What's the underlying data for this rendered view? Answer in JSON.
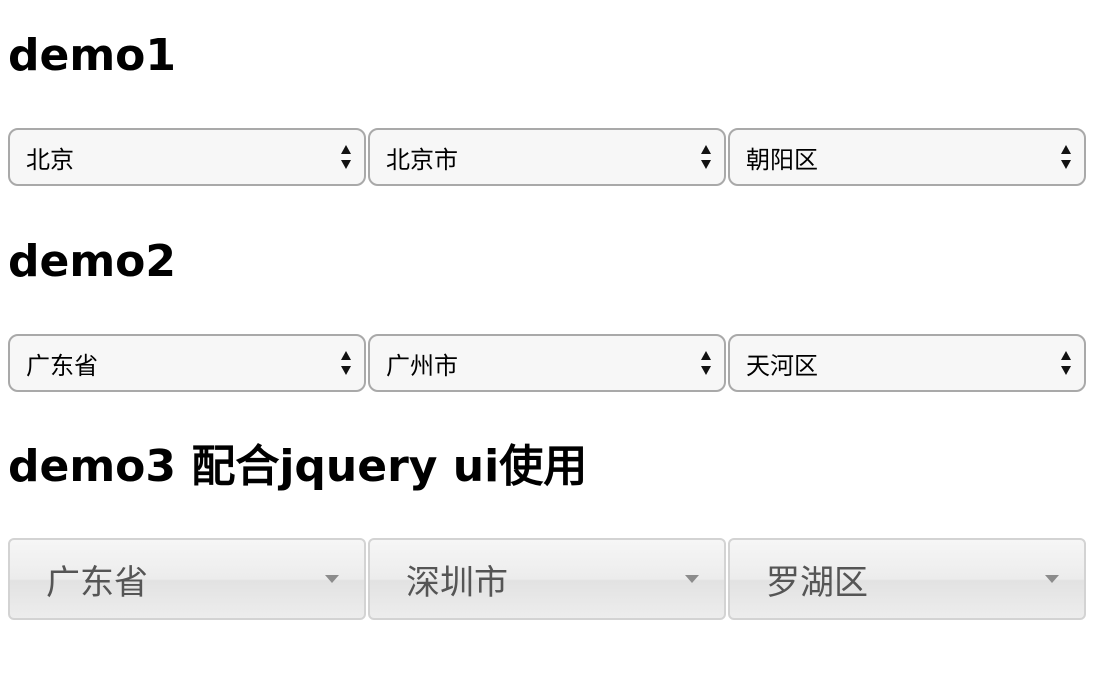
{
  "demo1": {
    "heading": "demo1",
    "province": "北京",
    "city": "北京市",
    "district": "朝阳区"
  },
  "demo2": {
    "heading": "demo2",
    "province": "广东省",
    "city": "广州市",
    "district": "天河区"
  },
  "demo3": {
    "heading": "demo3 配合jquery ui使用",
    "province": "广东省",
    "city": "深圳市",
    "district": "罗湖区"
  },
  "icons": {
    "native_select_arrow": "up-down-arrows-icon",
    "ui_select_arrow": "caret-down-icon"
  },
  "colors": {
    "native_border": "#a9a9a9",
    "native_background": "#f7f7f7",
    "ui_border": "#d3d3d3",
    "ui_text": "#555555"
  }
}
